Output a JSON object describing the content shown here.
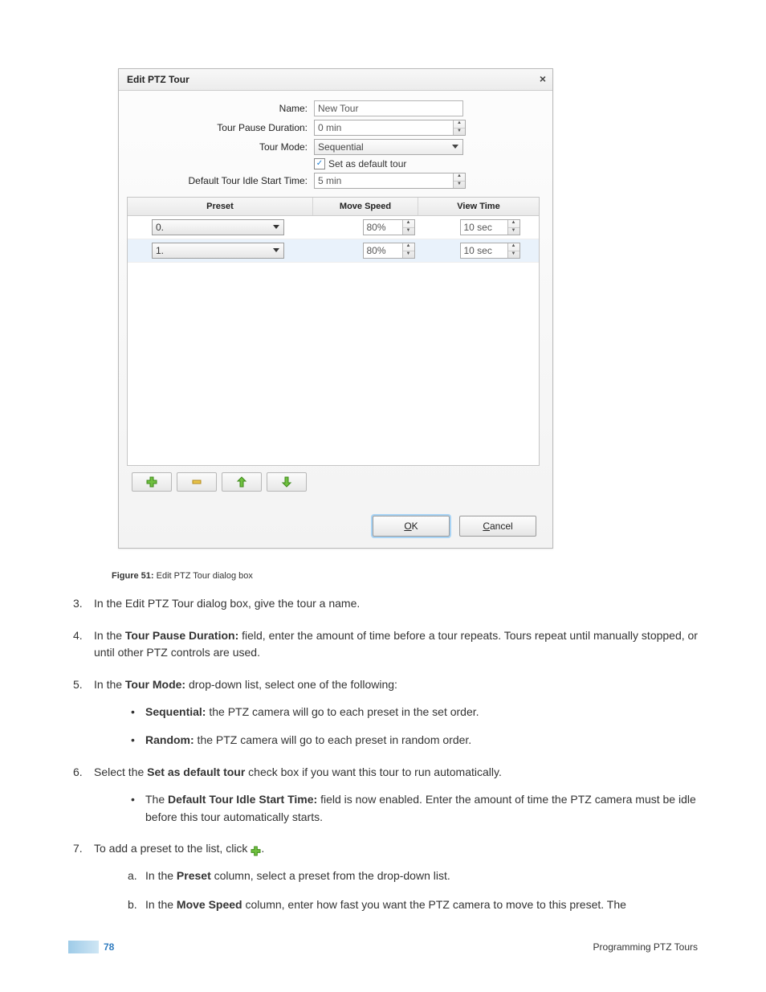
{
  "dialog": {
    "title": "Edit PTZ Tour",
    "labels": {
      "name": "Name:",
      "pause": "Tour Pause Duration:",
      "mode": "Tour Mode:",
      "default_chk": "Set as default tour",
      "idle": "Default Tour Idle Start Time:"
    },
    "values": {
      "name": "New Tour",
      "pause": "0 min",
      "mode": "Sequential",
      "idle": "5 min"
    },
    "grid": {
      "headers": {
        "preset": "Preset",
        "speed": "Move Speed",
        "time": "View Time"
      },
      "rows": [
        {
          "preset": "0.",
          "speed": "80%",
          "time": "10 sec"
        },
        {
          "preset": "1.",
          "speed": "80%",
          "time": "10 sec"
        }
      ]
    },
    "buttons": {
      "ok": "OK",
      "cancel": "Cancel"
    }
  },
  "caption": {
    "prefix": "Figure 51:",
    "text": " Edit PTZ Tour dialog box"
  },
  "steps": {
    "s3": "In the Edit PTZ Tour dialog box, give the tour a name.",
    "s4_a": "In the ",
    "s4_b": "Tour Pause Duration:",
    "s4_c": " field, enter the amount of time before a tour repeats. Tours repeat until manually stopped, or until other PTZ controls are used.",
    "s5_a": "In the ",
    "s5_b": "Tour Mode:",
    "s5_c": " drop-down list, select one of the following:",
    "s5_seq_a": "Sequential:",
    "s5_seq_b": " the PTZ camera will go to each preset in the set order.",
    "s5_rnd_a": "Random:",
    "s5_rnd_b": " the PTZ camera will go to each preset in random order.",
    "s6_a": "Select the ",
    "s6_b": "Set as default tour",
    "s6_c": " check box if you want this tour to run automatically.",
    "s6_sub_a": "The ",
    "s6_sub_b": "Default Tour Idle Start Time:",
    "s6_sub_c": " field is now enabled. Enter the amount of time the PTZ camera must be idle before this tour automatically starts.",
    "s7_a": "To add a preset to the list, click ",
    "s7_b": ".",
    "s7a_a": "In the ",
    "s7a_b": "Preset",
    "s7a_c": " column, select a preset from the drop-down list.",
    "s7b_a": "In the ",
    "s7b_b": "Move Speed",
    "s7b_c": " column, enter how fast you want the PTZ camera to move to this preset. The"
  },
  "footer": {
    "page": "78",
    "section": "Programming PTZ Tours"
  }
}
